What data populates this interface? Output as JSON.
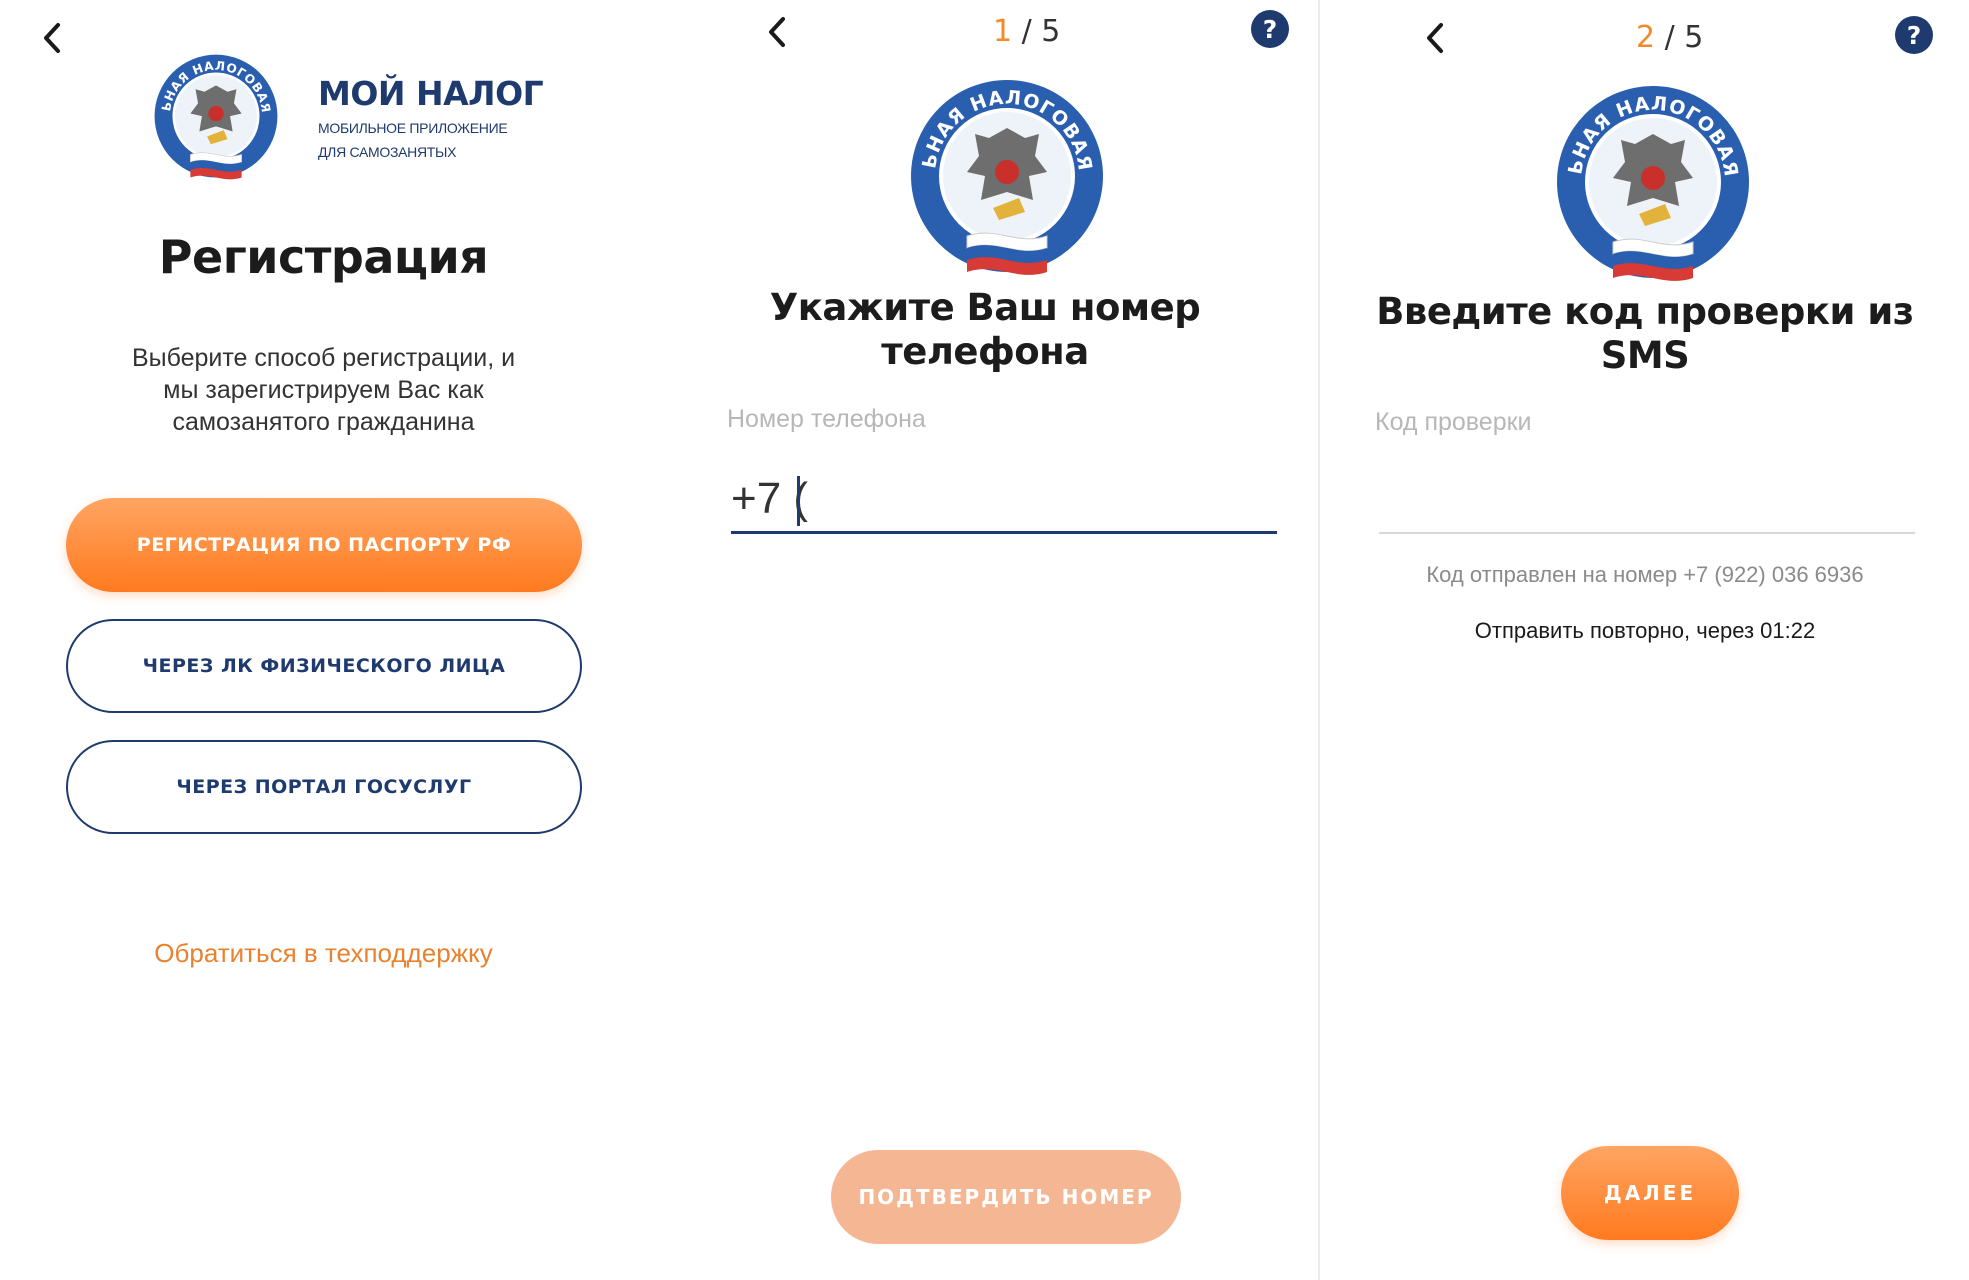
{
  "screen1": {
    "logo": {
      "emblem_text": "ФЕДЕРАЛЬНАЯ НАЛОГОВАЯ СЛУЖБА",
      "app_name": "МОЙ НАЛОГ",
      "subtitle_line1": "МОБИЛЬНОЕ ПРИЛОЖЕНИЕ",
      "subtitle_line2": "ДЛЯ САМОЗАНЯТЫХ"
    },
    "title": "Регистрация",
    "description_line1": "Выберите способ регистрации, и",
    "description_line2": "мы зарегистрируем Вас как",
    "description_line3": "самозанятого гражданина",
    "btn_passport": "РЕГИСТРАЦИЯ ПО ПАСПОРТУ РФ",
    "btn_lk": "ЧЕРЕЗ ЛК ФИЗИЧЕСКОГО ЛИЦА",
    "btn_gosuslugi": "ЧЕРЕЗ ПОРТАЛ ГОСУСЛУГ",
    "support_link": "Обратиться в техподдержку"
  },
  "screen2": {
    "step_current": "1",
    "step_total": " / 5",
    "help": "?",
    "emblem_text": "ФЕДЕРАЛЬНАЯ НАЛОГОВАЯ СЛУЖБА",
    "title_line1": "Укажите Ваш номер",
    "title_line2": "телефона",
    "field_label": "Номер телефона",
    "field_value": "+7 (",
    "btn_confirm": "ПОДТВЕРДИТЬ НОМЕР"
  },
  "screen3": {
    "step_current": "2",
    "step_total": " / 5",
    "help": "?",
    "emblem_text": "ФЕДЕРАЛЬНАЯ НАЛОГОВАЯ СЛУЖБА",
    "title_line1": "Введите код проверки из",
    "title_line2": "SMS",
    "field_label": "Код проверки",
    "sent_text": "Код отправлен на номер +7 (922) 036 6936",
    "resend_text": "Отправить повторно, через 01:22",
    "btn_next": "ДАЛЕЕ"
  },
  "colors": {
    "brand_navy": "#1f3a6e",
    "accent_orange": "#ff7a1f",
    "link_orange": "#e9822e",
    "disabled_orange": "#f5b793"
  },
  "icons": [
    "back-arrow-icon",
    "help-icon",
    "fns-emblem-icon"
  ]
}
